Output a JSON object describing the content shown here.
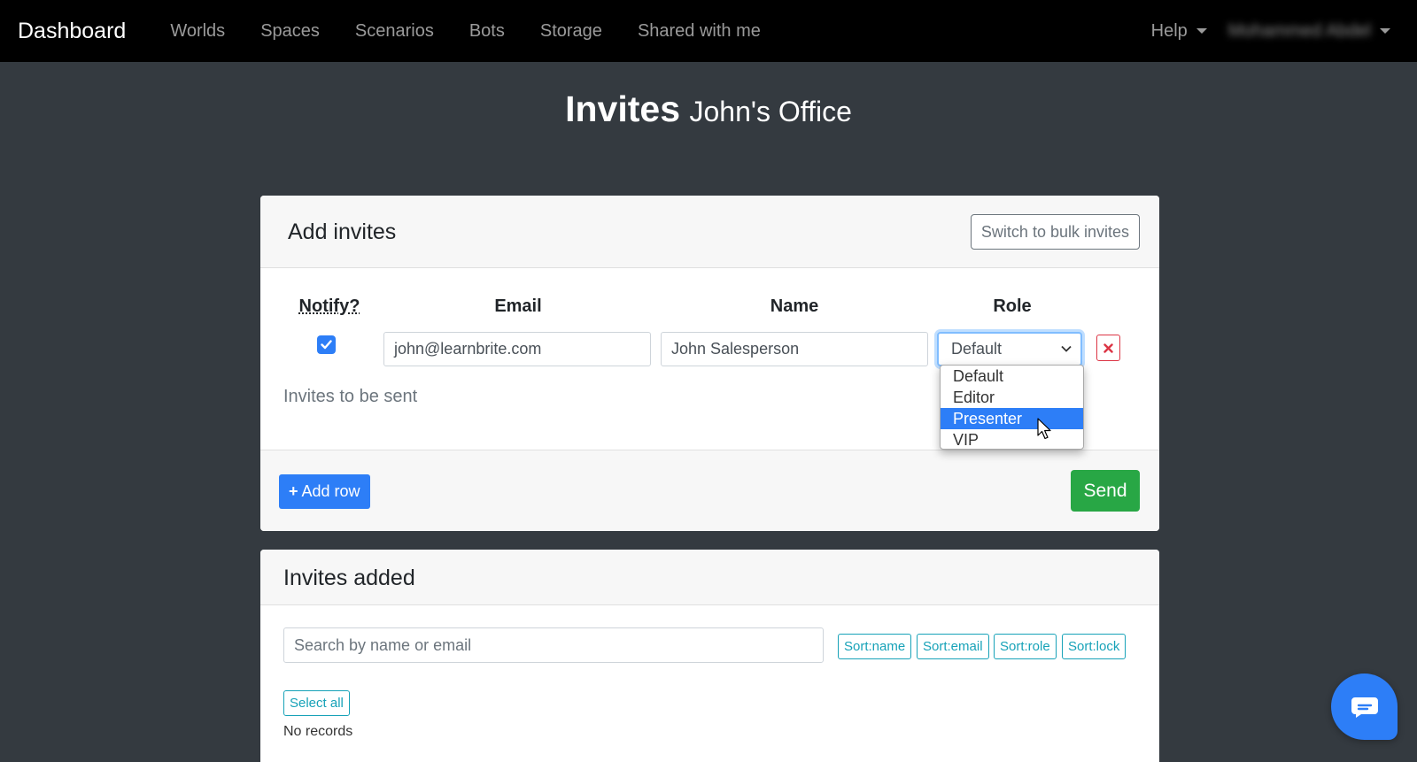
{
  "nav": {
    "brand": "Dashboard",
    "links": [
      "Worlds",
      "Spaces",
      "Scenarios",
      "Bots",
      "Storage",
      "Shared with me"
    ],
    "help": "Help",
    "user": "Mohammed Abdel"
  },
  "page": {
    "title": "Invites",
    "subtitle": "John's Office"
  },
  "add_invites": {
    "title": "Add invites",
    "bulk_button": "Switch to bulk invites",
    "columns": {
      "notify": "Notify?",
      "email": "Email",
      "name": "Name",
      "role": "Role"
    },
    "row": {
      "notify_checked": true,
      "email": "john@learnbrite.com",
      "name": "John Salesperson",
      "role": "Default"
    },
    "role_options": [
      "Default",
      "Editor",
      "Presenter",
      "VIP"
    ],
    "highlighted_option": "Presenter",
    "note": "Invites to be sent",
    "add_row_label": "Add row",
    "send_label": "Send"
  },
  "invites_added": {
    "title": "Invites added",
    "search_placeholder": "Search by name or email",
    "sort_buttons": [
      "Sort:name",
      "Sort:email",
      "Sort:role",
      "Sort:lock"
    ],
    "select_all": "Select all",
    "empty_text": "No records"
  },
  "colors": {
    "navbar": "#000000",
    "background": "#343a40",
    "primary": "#2d7ef7",
    "success": "#28a745",
    "info": "#17a2b8",
    "danger": "#dc3545"
  }
}
